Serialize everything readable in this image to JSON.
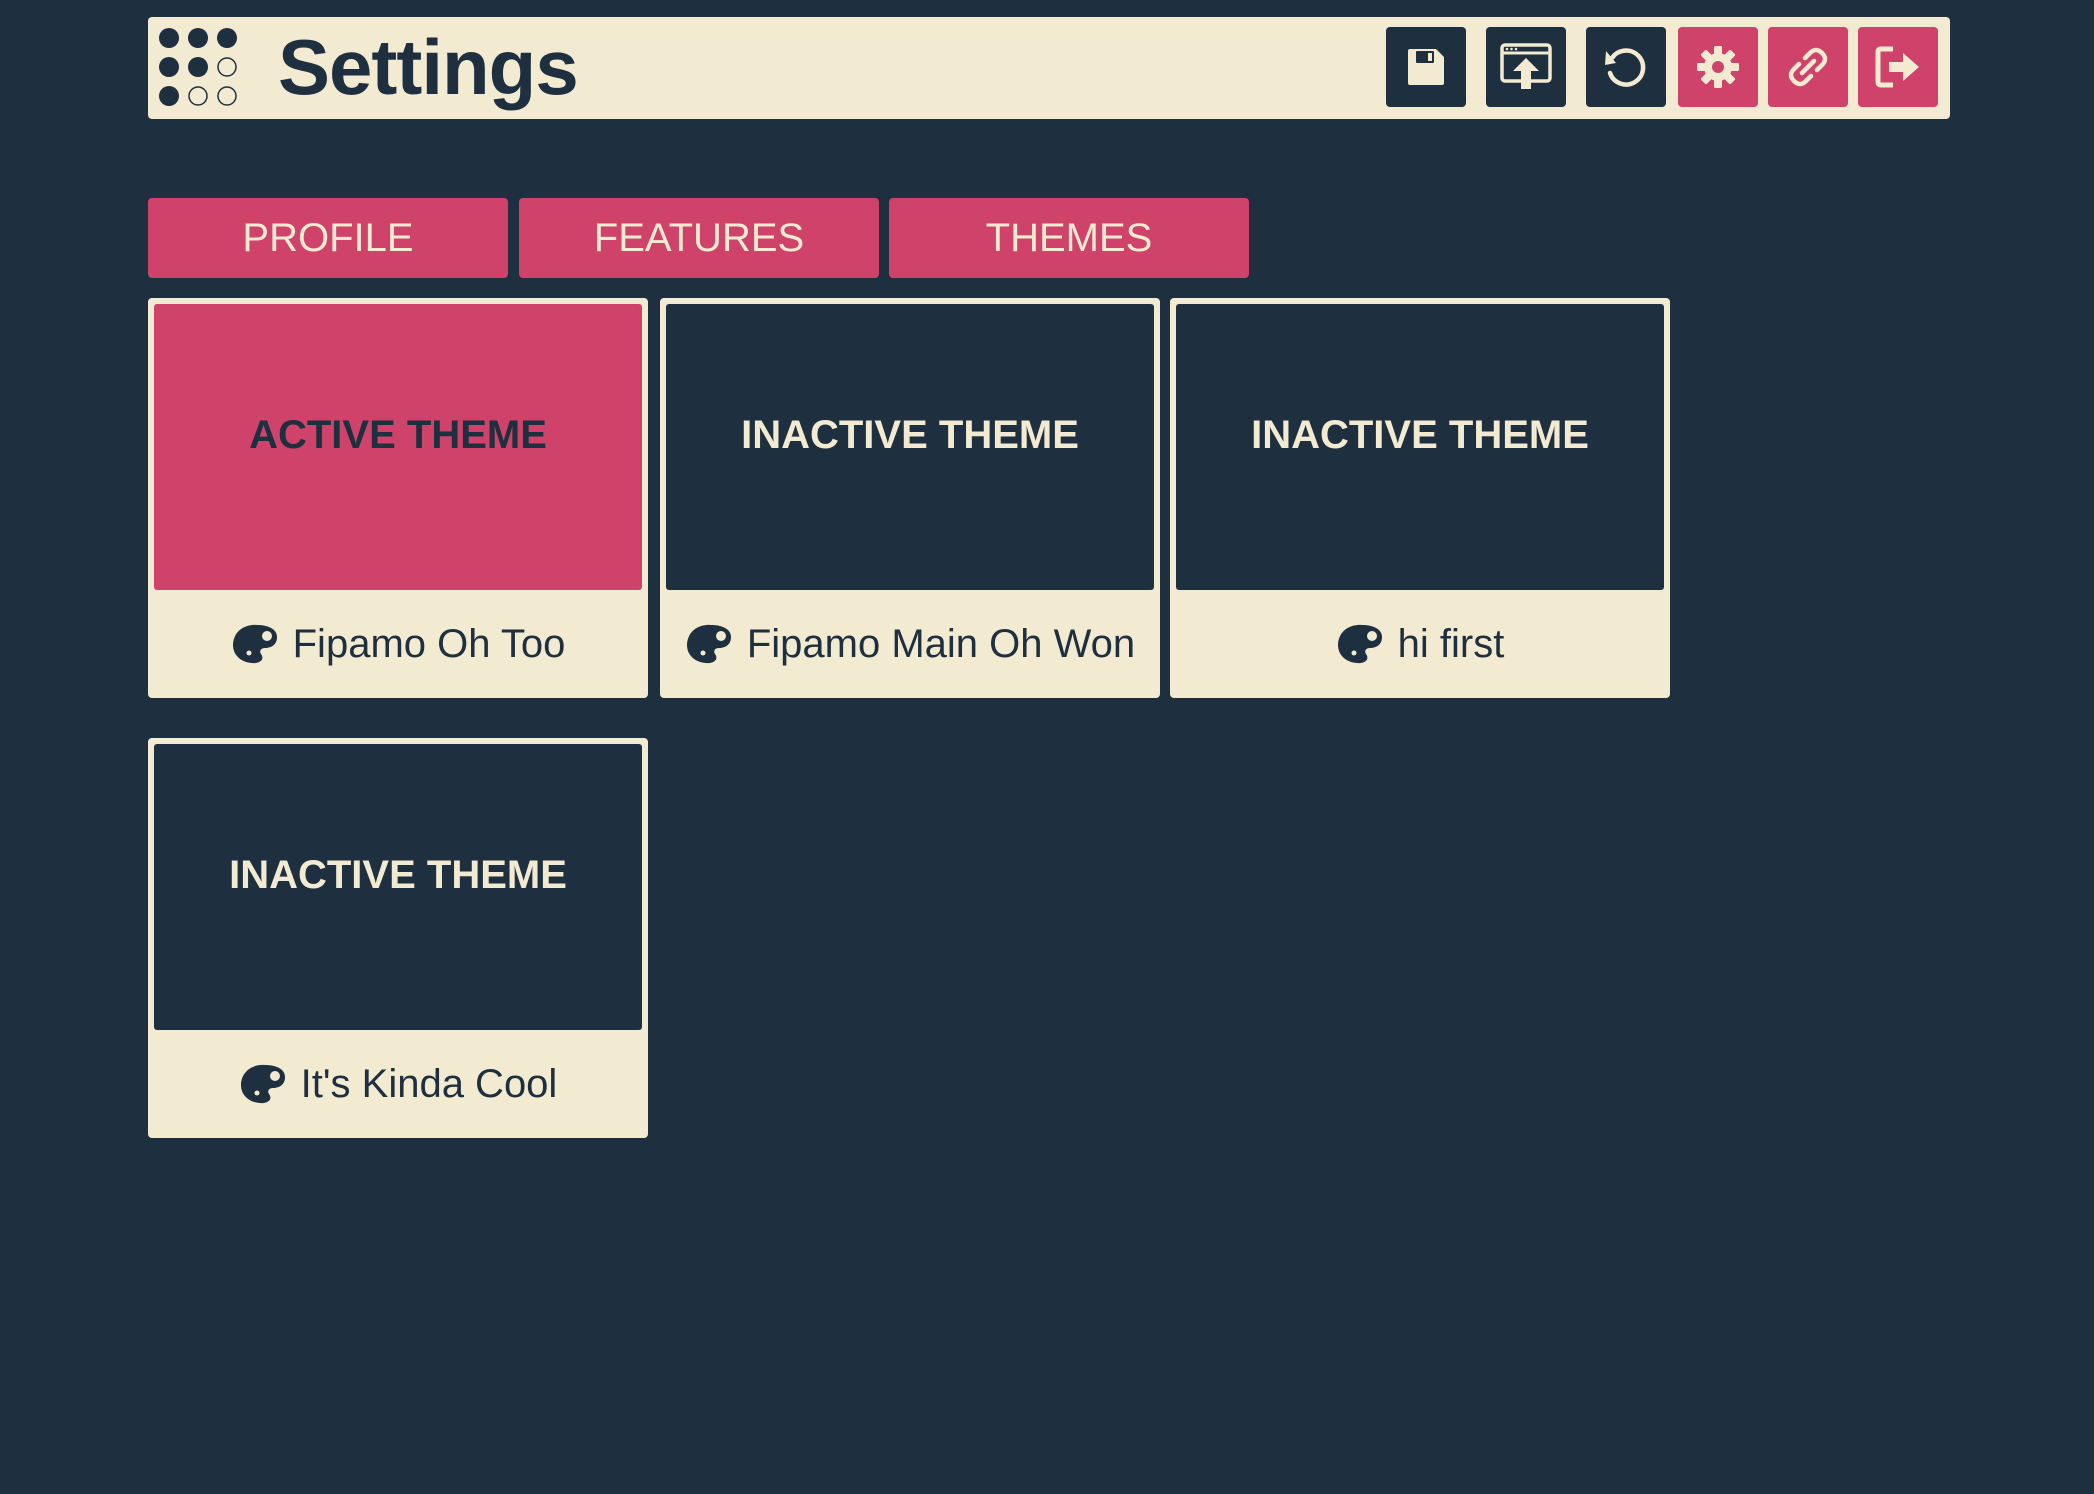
{
  "header": {
    "title": "Settings",
    "toolbar": [
      {
        "name": "save-button",
        "icon": "floppy-disk-icon",
        "style": "dark"
      },
      {
        "name": "publish-button",
        "icon": "upload-window-icon",
        "style": "dark"
      },
      {
        "name": "reindex-button",
        "icon": "refresh-icon",
        "style": "dark"
      },
      {
        "name": "settings-button",
        "icon": "gear-icon",
        "style": "pink"
      },
      {
        "name": "navigation-button",
        "icon": "link-icon",
        "style": "pink"
      },
      {
        "name": "logout-button",
        "icon": "logout-icon",
        "style": "pink"
      }
    ]
  },
  "tabs": [
    {
      "label": "PROFILE"
    },
    {
      "label": "FEATURES"
    },
    {
      "label": "THEMES"
    }
  ],
  "themes": [
    {
      "status": "ACTIVE THEME",
      "name": "Fipamo Oh Too",
      "active": true,
      "icon": "palette-icon"
    },
    {
      "status": "INACTIVE THEME",
      "name": "Fipamo Main Oh Won",
      "active": false,
      "icon": "palette-icon"
    },
    {
      "status": "INACTIVE THEME",
      "name": "hi first",
      "active": false,
      "icon": "palette-icon"
    },
    {
      "status": "INACTIVE THEME",
      "name": "It's Kinda Cool",
      "active": false,
      "icon": "palette-icon"
    }
  ],
  "colors": {
    "background": "#1e2f40",
    "cream": "#f3ead2",
    "accent": "#cf436a"
  }
}
